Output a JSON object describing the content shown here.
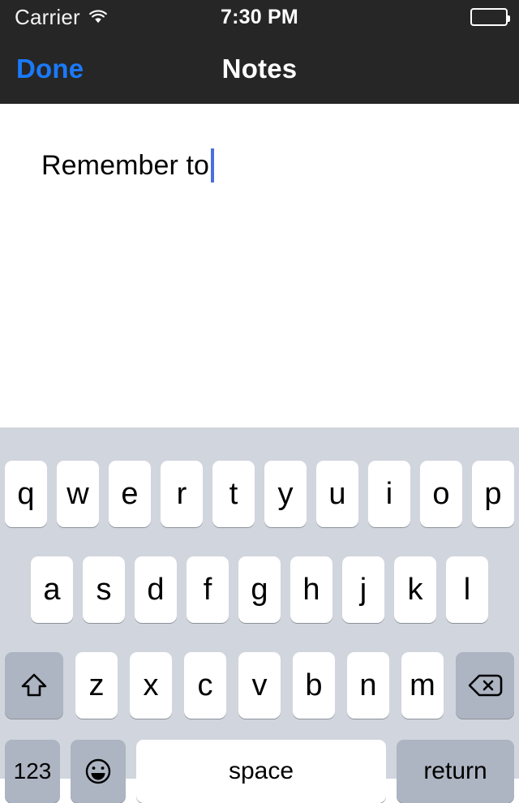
{
  "status_bar": {
    "carrier": "Carrier",
    "wifi_icon": "wifi-icon",
    "time": "7:30 PM",
    "battery_icon": "battery-full-icon"
  },
  "nav_bar": {
    "done_label": "Done",
    "title": "Notes",
    "done_color": "#1a7af8",
    "background": "#262626"
  },
  "note": {
    "text": "Remember to",
    "caret_color": "#4a6ee0"
  },
  "keyboard": {
    "background": "#d1d5dd",
    "key_color": "#ffffff",
    "modifier_key_color": "#adb4c2",
    "row1": [
      "q",
      "w",
      "e",
      "r",
      "t",
      "y",
      "u",
      "i",
      "o",
      "p"
    ],
    "row2": [
      "a",
      "s",
      "d",
      "f",
      "g",
      "h",
      "j",
      "k",
      "l"
    ],
    "row3": [
      "z",
      "x",
      "c",
      "v",
      "b",
      "n",
      "m"
    ],
    "shift_icon": "shift-icon",
    "backspace_icon": "backspace-icon",
    "numbers_label": "123",
    "emoji_icon": "emoji-smiley-icon",
    "space_label": "space",
    "return_label": "return"
  }
}
